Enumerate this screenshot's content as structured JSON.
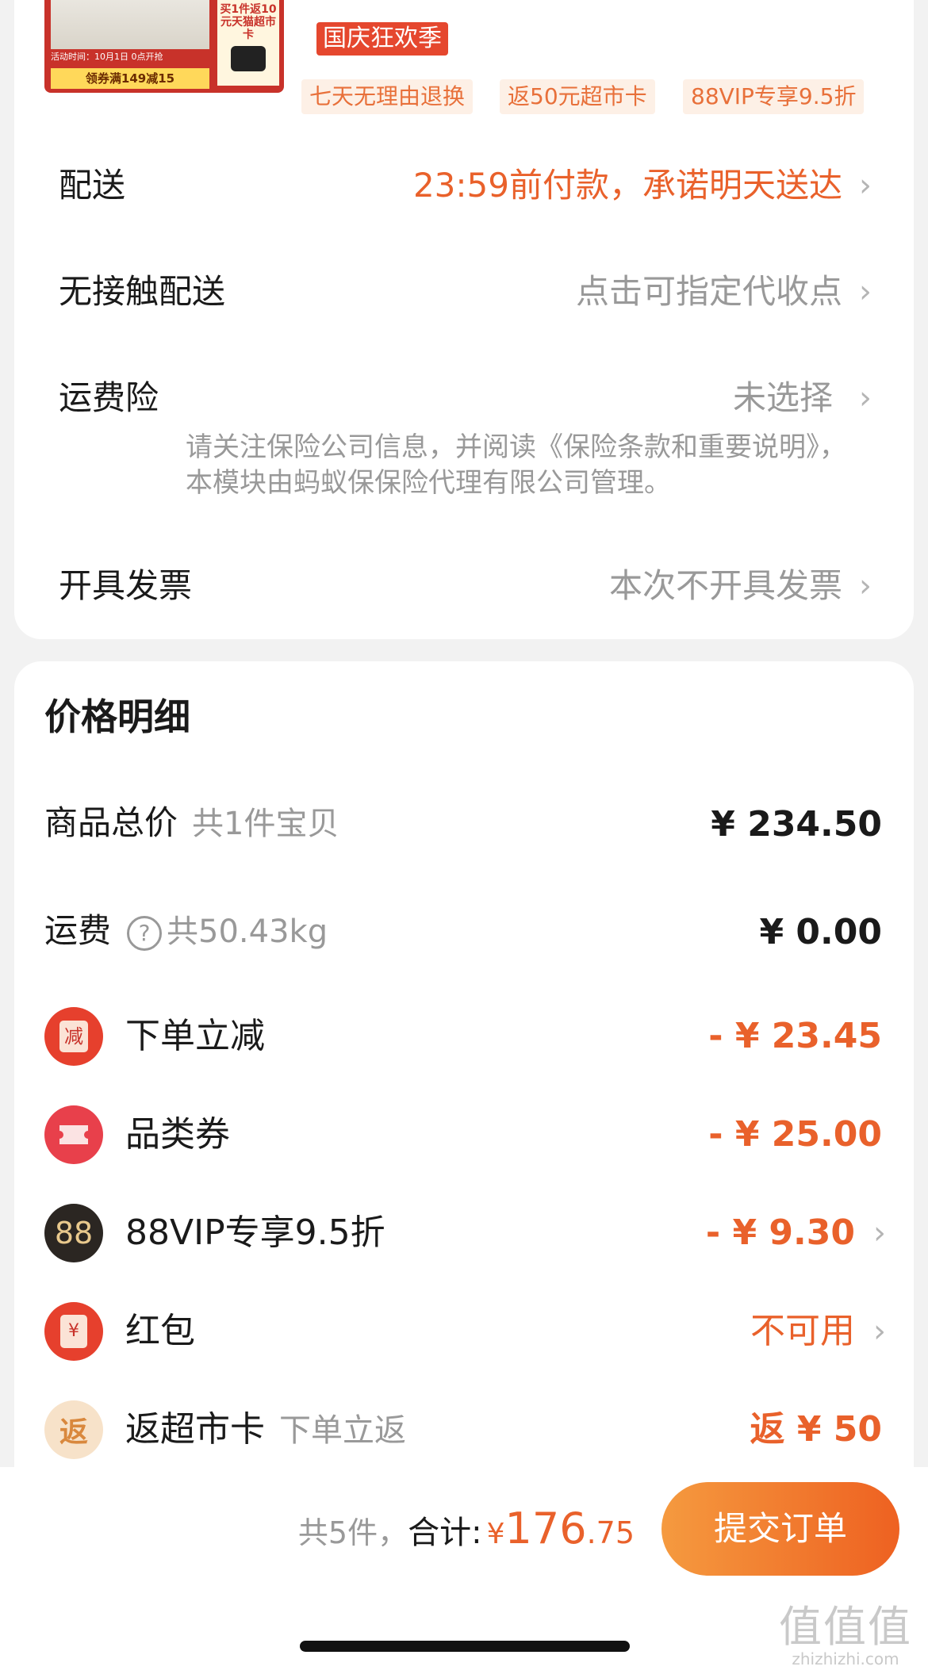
{
  "product": {
    "thumb_tag": "买1件返10元天猫超市卡",
    "thumb_event": "活动时间：10月1日 0点开抢",
    "thumb_coupon": "领券满149减15",
    "festival_badge": "国庆狂欢季",
    "chips": [
      "七天无理由退换",
      "返50元超市卡",
      "88VIP专享9.5折"
    ]
  },
  "delivery": {
    "label": "配送",
    "value": "23:59前付款，承诺明天送达"
  },
  "contactless": {
    "label": "无接触配送",
    "value": "点击可指定代收点"
  },
  "shipping_insurance": {
    "label": "运费险",
    "value": "未选择",
    "note": "请关注保险公司信息，并阅读《保险条款和重要说明》，本模块由蚂蚁保保险代理有限公司管理。"
  },
  "invoice": {
    "label": "开具发票",
    "value": "本次不开具发票"
  },
  "price_detail": {
    "title": "价格明细",
    "goods_total_label": "商品总价",
    "goods_count": "共1件宝贝",
    "goods_total": "¥ 234.50",
    "shipping_label": "运费",
    "weight": "共50.43kg",
    "shipping_fee": "¥ 0.00",
    "discounts": [
      {
        "icon": "reduce-icon",
        "icon_text": "减",
        "label": "下单立减",
        "value": "- ¥ 23.45",
        "color": "#e9612b"
      },
      {
        "icon": "ticket-icon",
        "icon_text": "",
        "label": "品类券",
        "value": "- ¥ 25.00",
        "color": "#e9612b"
      },
      {
        "icon": "vip88-icon",
        "icon_text": "88",
        "label": "88VIP专享9.5折",
        "value": "- ¥ 9.30",
        "color": "#e9612b"
      },
      {
        "icon": "red-packet-icon",
        "icon_text": "¥",
        "label": "红包",
        "value": "不可用",
        "color": "#e9612b"
      },
      {
        "icon": "rebate-icon",
        "icon_text": "返",
        "label": "返超市卡",
        "sub": "下单立返",
        "value": "返 ¥ 50",
        "color": "#e9612b"
      }
    ]
  },
  "footer": {
    "count": "共5件，",
    "total_label": "合计:",
    "currency": "¥",
    "total_int": "176",
    "total_dec": ".75",
    "submit_label": "提交订单"
  },
  "watermark": {
    "glyphs": "值值值",
    "url": "zhizhizhi.com"
  },
  "colors": {
    "accent": "#e9612b",
    "muted": "#999999",
    "submit_start": "#f59a3f",
    "submit_end": "#ee6121"
  }
}
